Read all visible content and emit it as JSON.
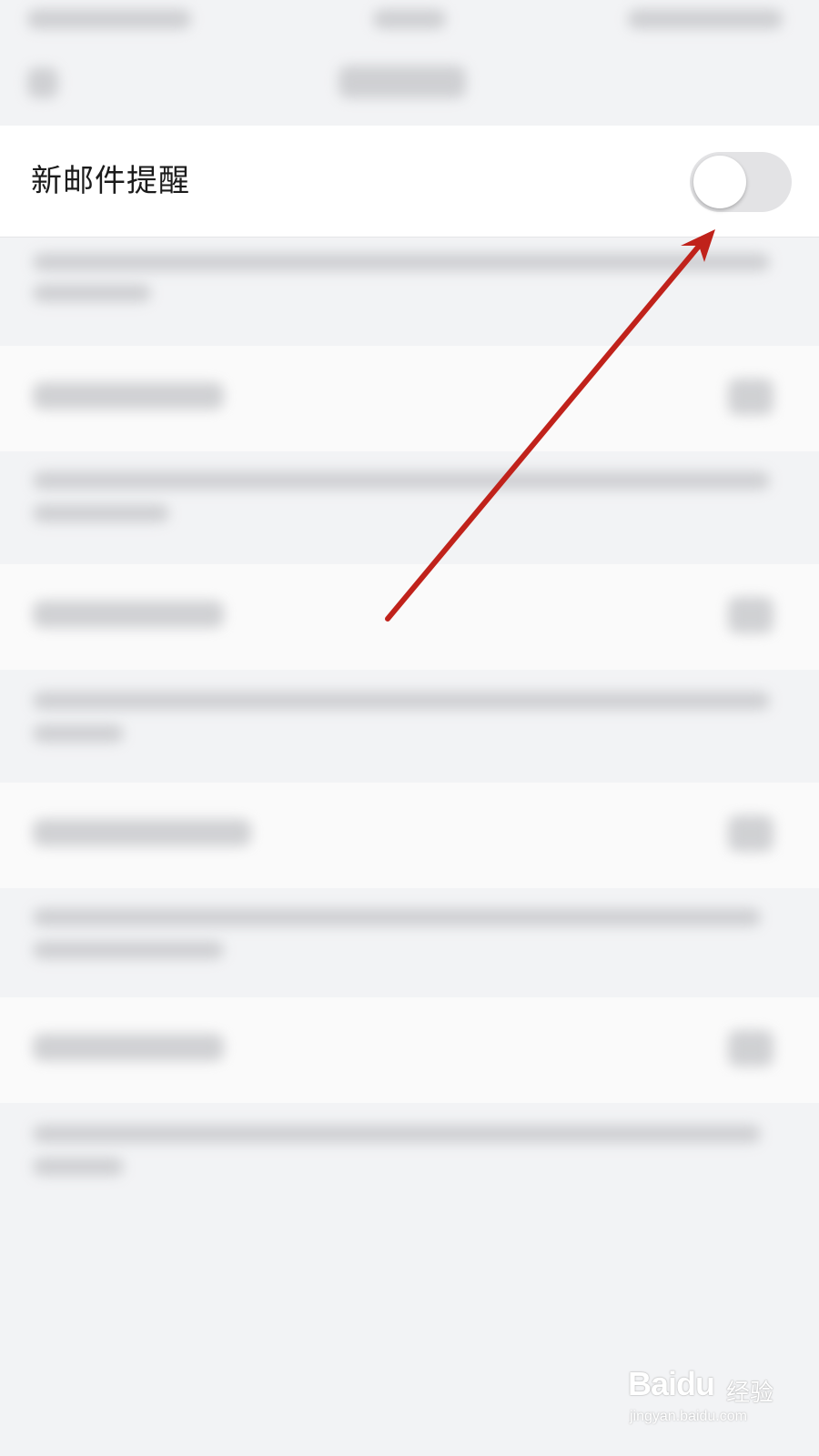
{
  "settings": {
    "new_mail_alert": {
      "label": "新邮件提醒",
      "enabled": false
    }
  },
  "annotation": {
    "arrow_color": "#c0221b"
  },
  "watermark": {
    "logo": "Baidu",
    "product": "经验",
    "url": "jingyan.baidu.com"
  },
  "colors": {
    "background": "#f2f3f5",
    "row_background": "#ffffff",
    "switch_off_track": "#e3e3e5"
  }
}
